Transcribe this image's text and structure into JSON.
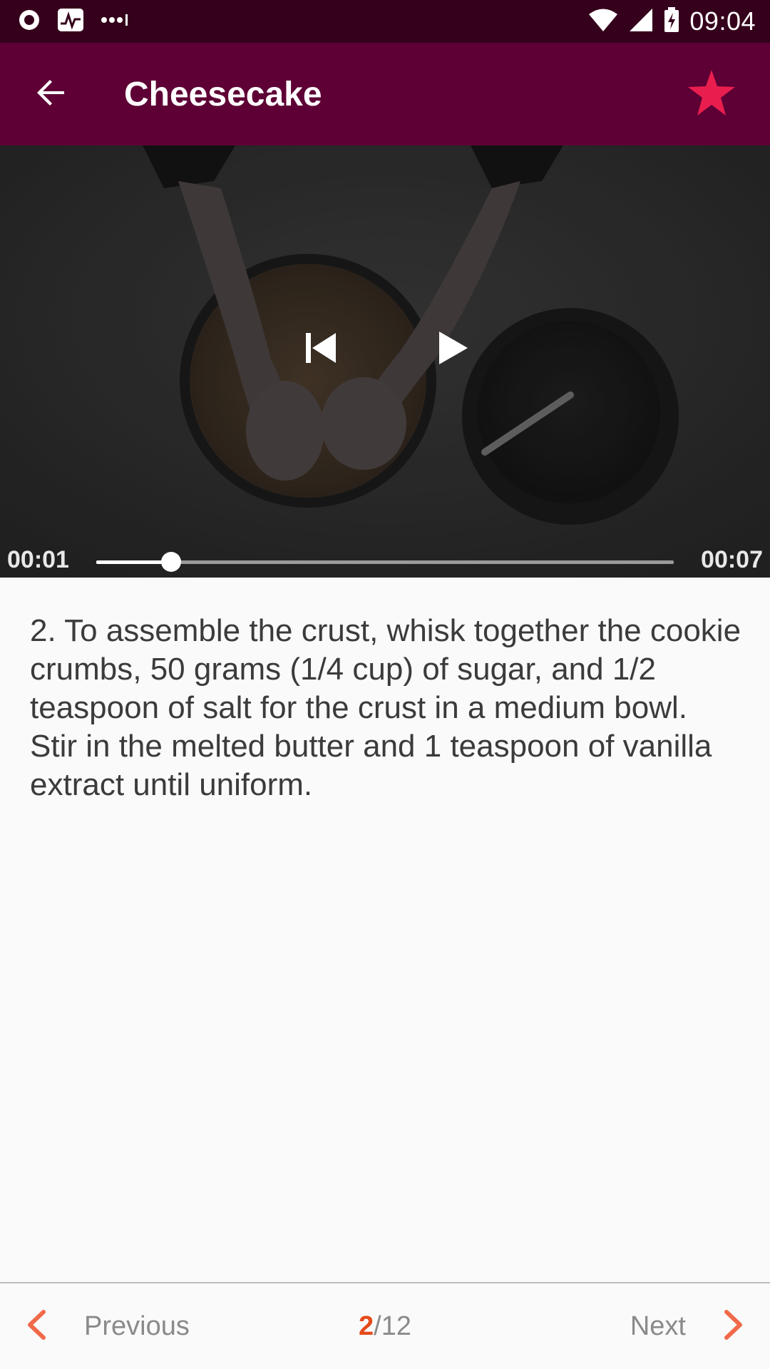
{
  "status_bar": {
    "time": "09:04",
    "left_icons": [
      "record-icon",
      "activity-icon",
      "more-dots-icon"
    ],
    "right_icons": [
      "wifi-icon",
      "cell-signal-icon",
      "battery-charging-icon"
    ]
  },
  "app_bar": {
    "title": "Cheesecake",
    "back_icon": "arrow-back-icon",
    "favorite_icon": "star-icon",
    "favorite_color": "#e91e4f",
    "background": "#5e0035"
  },
  "video": {
    "current_time": "00:01",
    "total_time": "00:07",
    "progress": 0.13,
    "controls": [
      "skip-previous-icon",
      "play-icon"
    ]
  },
  "step": {
    "text": "2. To assemble the crust, whisk together the cookie crumbs, 50 grams (1/4 cup) of sugar, and 1/2 teaspoon of salt for the crust in a medium bowl. Stir in the melted butter and 1 teaspoon of vanilla extract until uniform."
  },
  "navigation": {
    "previous_label": "Previous",
    "next_label": "Next",
    "current_page": "2",
    "total_pages": "/12",
    "accent_color": "#e64a19"
  }
}
